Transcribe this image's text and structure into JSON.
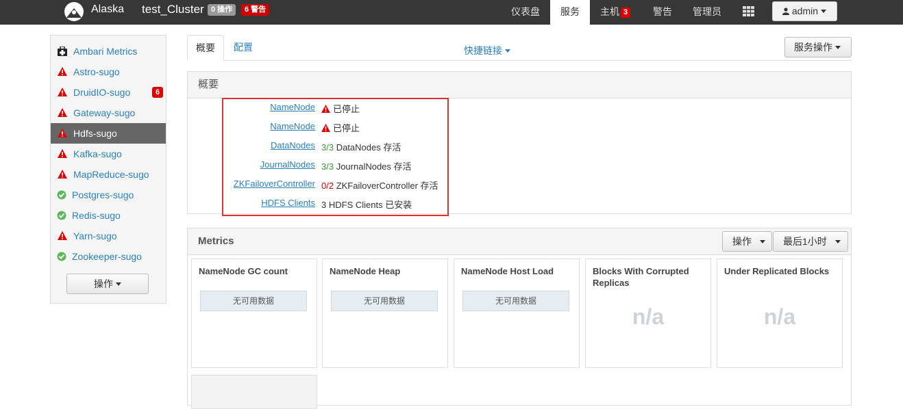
{
  "navbar": {
    "brand": "Alaska",
    "cluster": "test_Cluster",
    "ops_badge": "0 操作",
    "alerts_badge": "6 警告",
    "items": [
      {
        "label": "仪表盘"
      },
      {
        "label": "服务"
      },
      {
        "label": "主机",
        "badge": "3"
      },
      {
        "label": "警告"
      },
      {
        "label": "管理员"
      }
    ],
    "user": "admin"
  },
  "sidebar": {
    "services": [
      {
        "label": "Ambari Metrics",
        "status": "maintenance"
      },
      {
        "label": "Astro-sugo",
        "status": "alert"
      },
      {
        "label": "DruidIO-sugo",
        "status": "alert",
        "count": "6"
      },
      {
        "label": "Gateway-sugo",
        "status": "alert"
      },
      {
        "label": "Hdfs-sugo",
        "status": "alert"
      },
      {
        "label": "Kafka-sugo",
        "status": "alert"
      },
      {
        "label": "MapReduce-sugo",
        "status": "alert"
      },
      {
        "label": "Postgres-sugo",
        "status": "ok"
      },
      {
        "label": "Redis-sugo",
        "status": "ok"
      },
      {
        "label": "Yarn-sugo",
        "status": "alert"
      },
      {
        "label": "Zookeeper-sugo",
        "status": "ok"
      }
    ],
    "actions_label": "操作"
  },
  "tabs": {
    "summary": "概要",
    "configs": "配置",
    "quick_links": "快捷链接",
    "service_actions": "服务操作"
  },
  "summary": {
    "title": "概要",
    "rows": [
      {
        "name": "NameNode",
        "count": "",
        "text": "已停止",
        "warn": true
      },
      {
        "name": "NameNode",
        "count": "",
        "text": "已停止",
        "warn": true
      },
      {
        "name": "DataNodes",
        "count": "3/3",
        "text": " DataNodes 存活",
        "warn": false
      },
      {
        "name": "JournalNodes",
        "count": "3/3",
        "text": " JournalNodes 存活",
        "warn": false
      },
      {
        "name": "ZKFailoverController",
        "count": "0/2",
        "text": " ZKFailoverController 存活",
        "warn": false
      },
      {
        "name": "HDFS Clients",
        "count": "3",
        "text": " HDFS Clients 已安装",
        "warn": false
      }
    ]
  },
  "metrics": {
    "title": "Metrics",
    "actions_label": "操作",
    "range_label": "最后1小时",
    "widgets": [
      {
        "title": "NameNode GC count",
        "value": "无可用数据"
      },
      {
        "title": "NameNode Heap",
        "value": "无可用数据"
      },
      {
        "title": "NameNode Host Load",
        "value": "无可用数据"
      },
      {
        "title": "Blocks With Corrupted Replicas",
        "value": "n/a"
      },
      {
        "title": "Under Replicated Blocks",
        "value": "n/a"
      }
    ]
  },
  "colors": {
    "navbar": "#373737",
    "link": "#2a80c0",
    "alert": "#dd0000",
    "ok": "#3a9a3a"
  }
}
